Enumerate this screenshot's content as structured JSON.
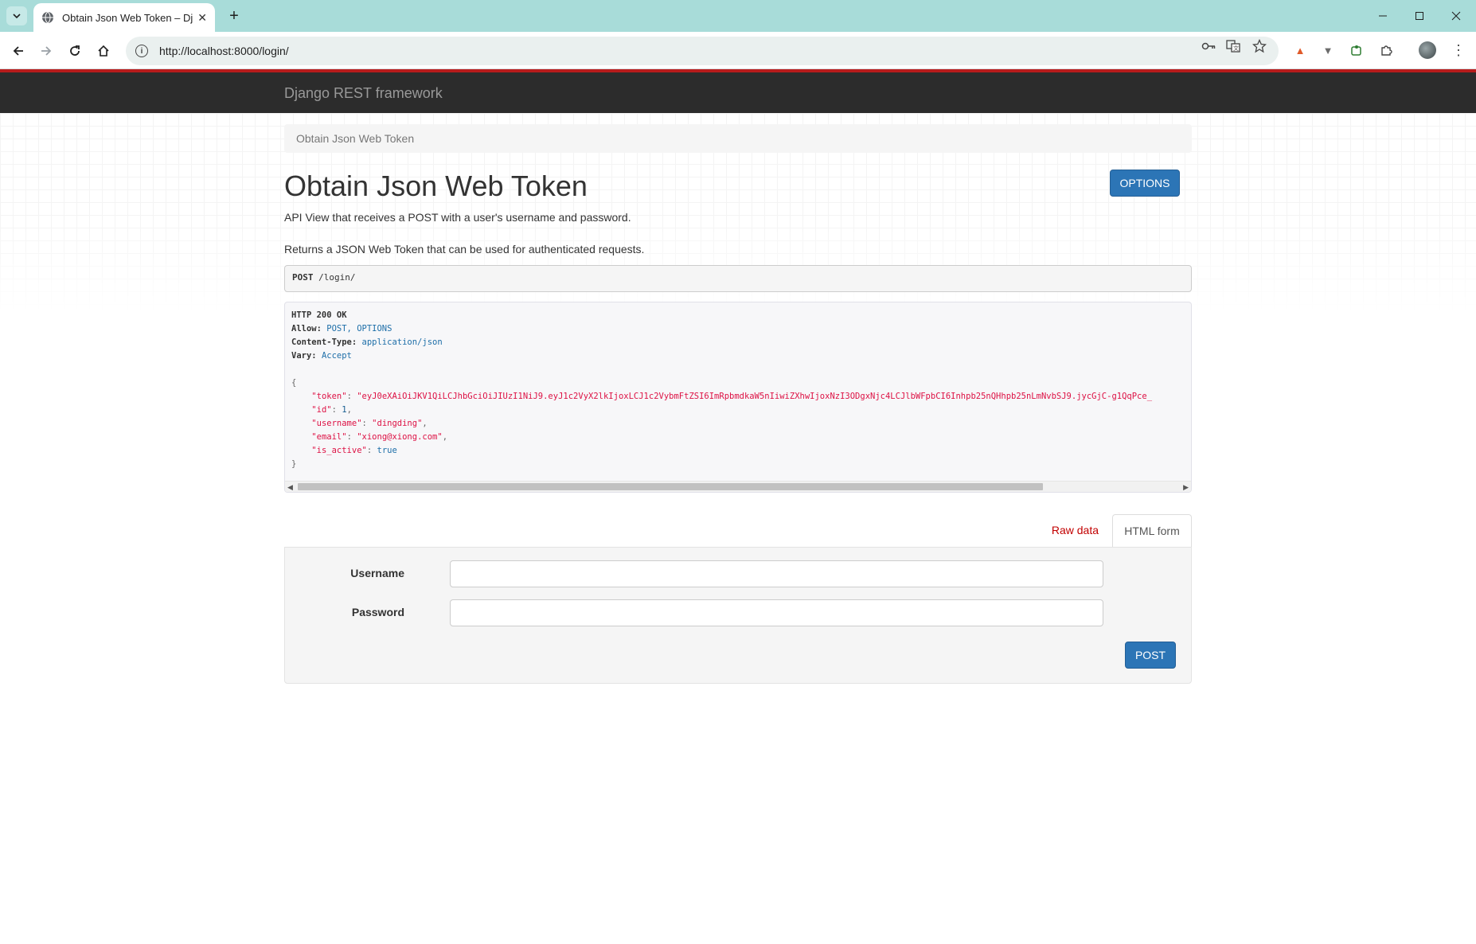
{
  "browser": {
    "tab_title": "Obtain Json Web Token – Dja",
    "url": "http://localhost:8000/login/"
  },
  "navbar": {
    "brand": "Django REST framework"
  },
  "breadcrumb": {
    "current": "Obtain Json Web Token"
  },
  "page": {
    "title": "Obtain Json Web Token",
    "options_label": "OPTIONS",
    "description_1": "API View that receives a POST with a user's username and password.",
    "description_2": "Returns a JSON Web Token that can be used for authenticated requests."
  },
  "request": {
    "method": "POST",
    "path": "/login/"
  },
  "response": {
    "status": "HTTP 200 OK",
    "allow_label": "Allow:",
    "allow_values": "POST, OPTIONS",
    "content_type_label": "Content-Type:",
    "content_type_value": "application/json",
    "vary_label": "Vary:",
    "vary_value": "Accept",
    "token_key": "\"token\"",
    "token_value": "\"eyJ0eXAiOiJKV1QiLCJhbGciOiJIUzI1NiJ9.eyJ1c2VyX2lkIjoxLCJ1c2VybmFtZSI6ImRpbmdkaW5nIiwiZXhwIjoxNzI3ODgxNjc4LCJlbWFpbCI6Inhpb25nQHhpb25nLmNvbSJ9.jycGjC-g1QqPce_",
    "id_key": "\"id\"",
    "id_value": "1",
    "username_key": "\"username\"",
    "username_value": "\"dingding\"",
    "email_key": "\"email\"",
    "email_value": "\"xiong@xiong.com\"",
    "is_active_key": "\"is_active\"",
    "is_active_value": "true"
  },
  "form_tabs": {
    "raw": "Raw data",
    "html": "HTML form"
  },
  "form": {
    "username_label": "Username",
    "password_label": "Password",
    "username_value": "",
    "password_value": "",
    "submit_label": "POST"
  },
  "colors": {
    "navbar_bg": "#2c2c2c",
    "primary_button": "#2c75b6",
    "raw_tab_link": "#c20000",
    "chrome_tabbar": "#a8dcd9"
  }
}
